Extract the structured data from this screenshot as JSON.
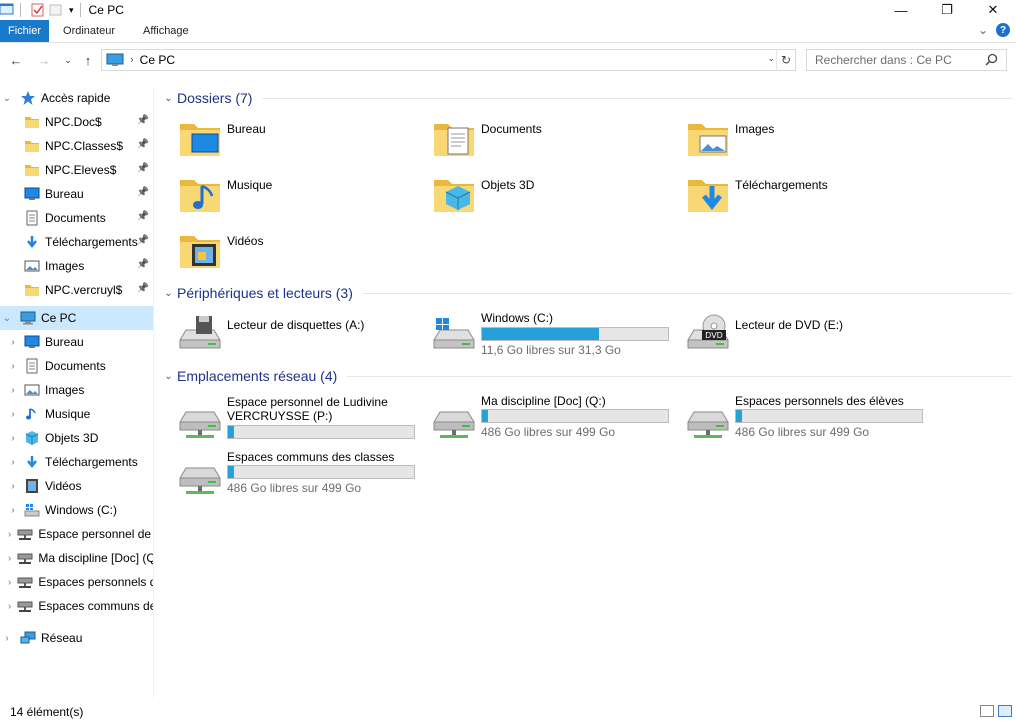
{
  "window": {
    "title": "Ce PC",
    "minimize": "—",
    "maximize": "❐",
    "close": "✕"
  },
  "ribbon": {
    "tabs": [
      "Fichier",
      "Ordinateur",
      "Affichage"
    ],
    "expand": "⌄",
    "help": "?"
  },
  "nav": {
    "back": "←",
    "forward": "→",
    "recent": "⌄",
    "up": "↑",
    "address": "Ce PC",
    "search_placeholder": "Rechercher dans : Ce PC"
  },
  "tree": [
    {
      "label": "Accès rapide",
      "icon": "star-icon",
      "indent": 0,
      "chev": "⌄",
      "pin": false
    },
    {
      "label": "NPC.Doc$",
      "icon": "folder-icon",
      "indent": 1,
      "chev": "",
      "pin": true
    },
    {
      "label": "NPC.Classes$",
      "icon": "folder-icon",
      "indent": 1,
      "chev": "",
      "pin": true
    },
    {
      "label": "NPC.Eleves$",
      "icon": "folder-icon",
      "indent": 1,
      "chev": "",
      "pin": true
    },
    {
      "label": "Bureau",
      "icon": "desktop-icon",
      "indent": 1,
      "chev": "",
      "pin": true
    },
    {
      "label": "Documents",
      "icon": "document-icon",
      "indent": 1,
      "chev": "",
      "pin": true
    },
    {
      "label": "Téléchargements",
      "icon": "download-icon",
      "indent": 1,
      "chev": "",
      "pin": true
    },
    {
      "label": "Images",
      "icon": "image-icon",
      "indent": 1,
      "chev": "",
      "pin": true
    },
    {
      "label": "NPC.vercruyl$",
      "icon": "folder-icon",
      "indent": 1,
      "chev": "",
      "pin": true
    },
    {
      "label": "Ce PC",
      "icon": "computer-icon",
      "indent": 0,
      "chev": "⌄",
      "pin": false,
      "selected": true
    },
    {
      "label": "Bureau",
      "icon": "desktop-icon",
      "indent": 1,
      "chev": "›",
      "pin": false
    },
    {
      "label": "Documents",
      "icon": "document-icon",
      "indent": 1,
      "chev": "›",
      "pin": false
    },
    {
      "label": "Images",
      "icon": "image-icon",
      "indent": 1,
      "chev": "›",
      "pin": false
    },
    {
      "label": "Musique",
      "icon": "music-icon",
      "indent": 1,
      "chev": "›",
      "pin": false
    },
    {
      "label": "Objets 3D",
      "icon": "cube-icon",
      "indent": 1,
      "chev": "›",
      "pin": false
    },
    {
      "label": "Téléchargements",
      "icon": "download-icon",
      "indent": 1,
      "chev": "›",
      "pin": false
    },
    {
      "label": "Vidéos",
      "icon": "film-icon",
      "indent": 1,
      "chev": "›",
      "pin": false
    },
    {
      "label": "Windows (C:)",
      "icon": "windows-drive-icon",
      "indent": 1,
      "chev": "›",
      "pin": false
    },
    {
      "label": "Espace personnel de Ludivine",
      "icon": "network-drive-icon",
      "indent": 1,
      "chev": "›",
      "pin": false
    },
    {
      "label": "Ma discipline [Doc] (Q:)",
      "icon": "network-drive-icon",
      "indent": 1,
      "chev": "›",
      "pin": false
    },
    {
      "label": "Espaces personnels des élèves (R:)",
      "icon": "network-drive-icon",
      "indent": 1,
      "chev": "›",
      "pin": false
    },
    {
      "label": "Espaces communs des classes (S:)",
      "icon": "network-drive-icon",
      "indent": 1,
      "chev": "›",
      "pin": false
    },
    {
      "label": "Réseau",
      "icon": "network-icon",
      "indent": 0,
      "chev": "›",
      "pin": false
    }
  ],
  "groups": {
    "folders": {
      "title": "Dossiers (7)"
    },
    "devices": {
      "title": "Périphériques et lecteurs (3)"
    },
    "network": {
      "title": "Emplacements réseau (4)"
    }
  },
  "folders": [
    {
      "name": "Bureau",
      "icon": "desktop-folder-icon"
    },
    {
      "name": "Documents",
      "icon": "documents-folder-icon"
    },
    {
      "name": "Images",
      "icon": "images-folder-icon"
    },
    {
      "name": "Musique",
      "icon": "music-folder-icon"
    },
    {
      "name": "Objets 3D",
      "icon": "objects3d-folder-icon"
    },
    {
      "name": "Téléchargements",
      "icon": "downloads-folder-icon"
    },
    {
      "name": "Vidéos",
      "icon": "videos-folder-icon"
    }
  ],
  "devices": [
    {
      "name": "Lecteur de disquettes (A:)",
      "icon": "floppy-drive-icon",
      "free": "",
      "used_fraction": null
    },
    {
      "name": "Windows (C:)",
      "icon": "windows-drive-icon",
      "free": "11,6 Go libres sur 31,3 Go",
      "used_fraction": 0.63
    },
    {
      "name": "Lecteur de DVD (E:)",
      "icon": "dvd-drive-icon",
      "free": "",
      "used_fraction": null
    }
  ],
  "network_locations": [
    {
      "name": "Espace personnel de Ludivine VERCRUYSSE (P:)",
      "icon": "network-drive-icon",
      "free": "",
      "used_fraction": 0.03
    },
    {
      "name": "Ma discipline [Doc] (Q:)",
      "icon": "network-drive-icon",
      "free": "486 Go libres sur 499 Go",
      "used_fraction": 0.03
    },
    {
      "name": "Espaces personnels des élèves (R:)",
      "icon": "network-drive-icon",
      "free": "486 Go libres sur 499 Go",
      "used_fraction": 0.03
    },
    {
      "name": "Espaces communs des classes (S:)",
      "icon": "network-drive-icon",
      "free": "486 Go libres sur 499 Go",
      "used_fraction": 0.03
    }
  ],
  "status": {
    "count": "14 élément(s)"
  },
  "colors": {
    "accent": "#1979ca",
    "bar_fill": "#26a0da",
    "group_title": "#1e3287",
    "selected": "#cce8ff"
  }
}
